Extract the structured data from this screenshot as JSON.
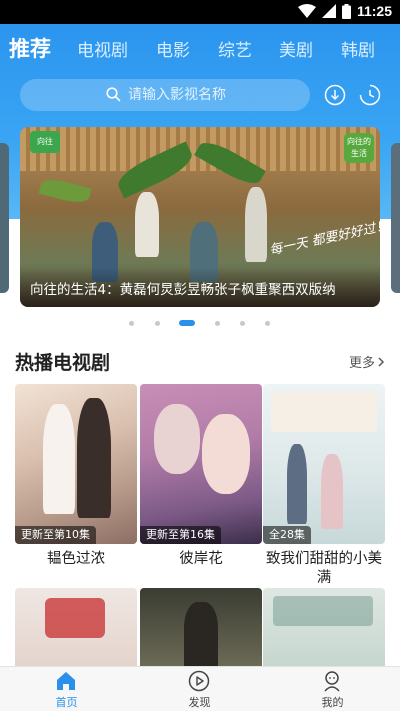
{
  "status_bar": {
    "time": "11:25",
    "wifi_icon": "wifi-icon",
    "signal_icon": "signal-icon",
    "battery_icon": "battery-icon"
  },
  "tabs": [
    {
      "label": "推荐",
      "active": true
    },
    {
      "label": "电视剧"
    },
    {
      "label": "电影"
    },
    {
      "label": "综艺"
    },
    {
      "label": "美剧"
    },
    {
      "label": "韩剧"
    }
  ],
  "search": {
    "placeholder": "请输入影视名称",
    "icon": "search-icon"
  },
  "toolbar": {
    "download_icon": "download-icon",
    "history_icon": "history-clock-icon"
  },
  "banner": {
    "caption": "向往的生活4：黄磊何炅彭昱畅张子枫重聚西双版纳",
    "logo_left": "向往",
    "logo_right": "向往的生活",
    "slogan": "每一天 都要好好过！",
    "page_count": 6,
    "active_index": 2
  },
  "section": {
    "title": "热播电视剧",
    "more_label": "更多"
  },
  "cards": [
    {
      "title": "韫色过浓",
      "badge": "更新至第10集"
    },
    {
      "title": "彼岸花",
      "badge": "更新至第16集"
    },
    {
      "title": "致我们甜甜的小美满",
      "badge": "全28集"
    }
  ],
  "bottom_nav": [
    {
      "label": "首页",
      "icon": "home-icon",
      "active": true
    },
    {
      "label": "发现",
      "icon": "play-circle-icon"
    },
    {
      "label": "我的",
      "icon": "user-icon"
    }
  ],
  "colors": {
    "accent": "#2a90ec",
    "header_top": "#2b95ef",
    "header_bottom": "#58b7f6"
  }
}
